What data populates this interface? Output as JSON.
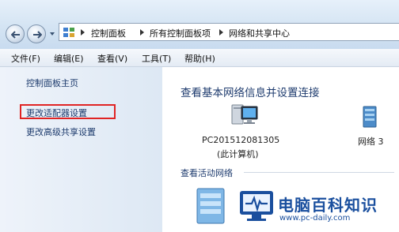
{
  "breadcrumb": {
    "items": [
      "控制面板",
      "所有控制面板项",
      "网络和共享中心"
    ]
  },
  "menu": {
    "items": [
      "文件(F)",
      "编辑(E)",
      "查看(V)",
      "工具(T)",
      "帮助(H)"
    ]
  },
  "sidebar": {
    "items": [
      {
        "label": "控制面板主页"
      },
      {
        "label": "更改适配器设置",
        "highlighted": true
      },
      {
        "label": "更改高级共享设置"
      }
    ]
  },
  "main": {
    "title": "查看基本网络信息并设置连接",
    "computer": {
      "name": "PC201512081305",
      "subtitle": "(此计算机)"
    },
    "network": {
      "label": "网络 3"
    },
    "active_heading": "查看活动网络"
  },
  "watermark": {
    "title": "电脑百科知识",
    "url": "www.pc-daily.com"
  },
  "colors": {
    "highlight_box": "#e02424",
    "link": "#1c3a6c",
    "watermark": "#1a4f9e"
  }
}
